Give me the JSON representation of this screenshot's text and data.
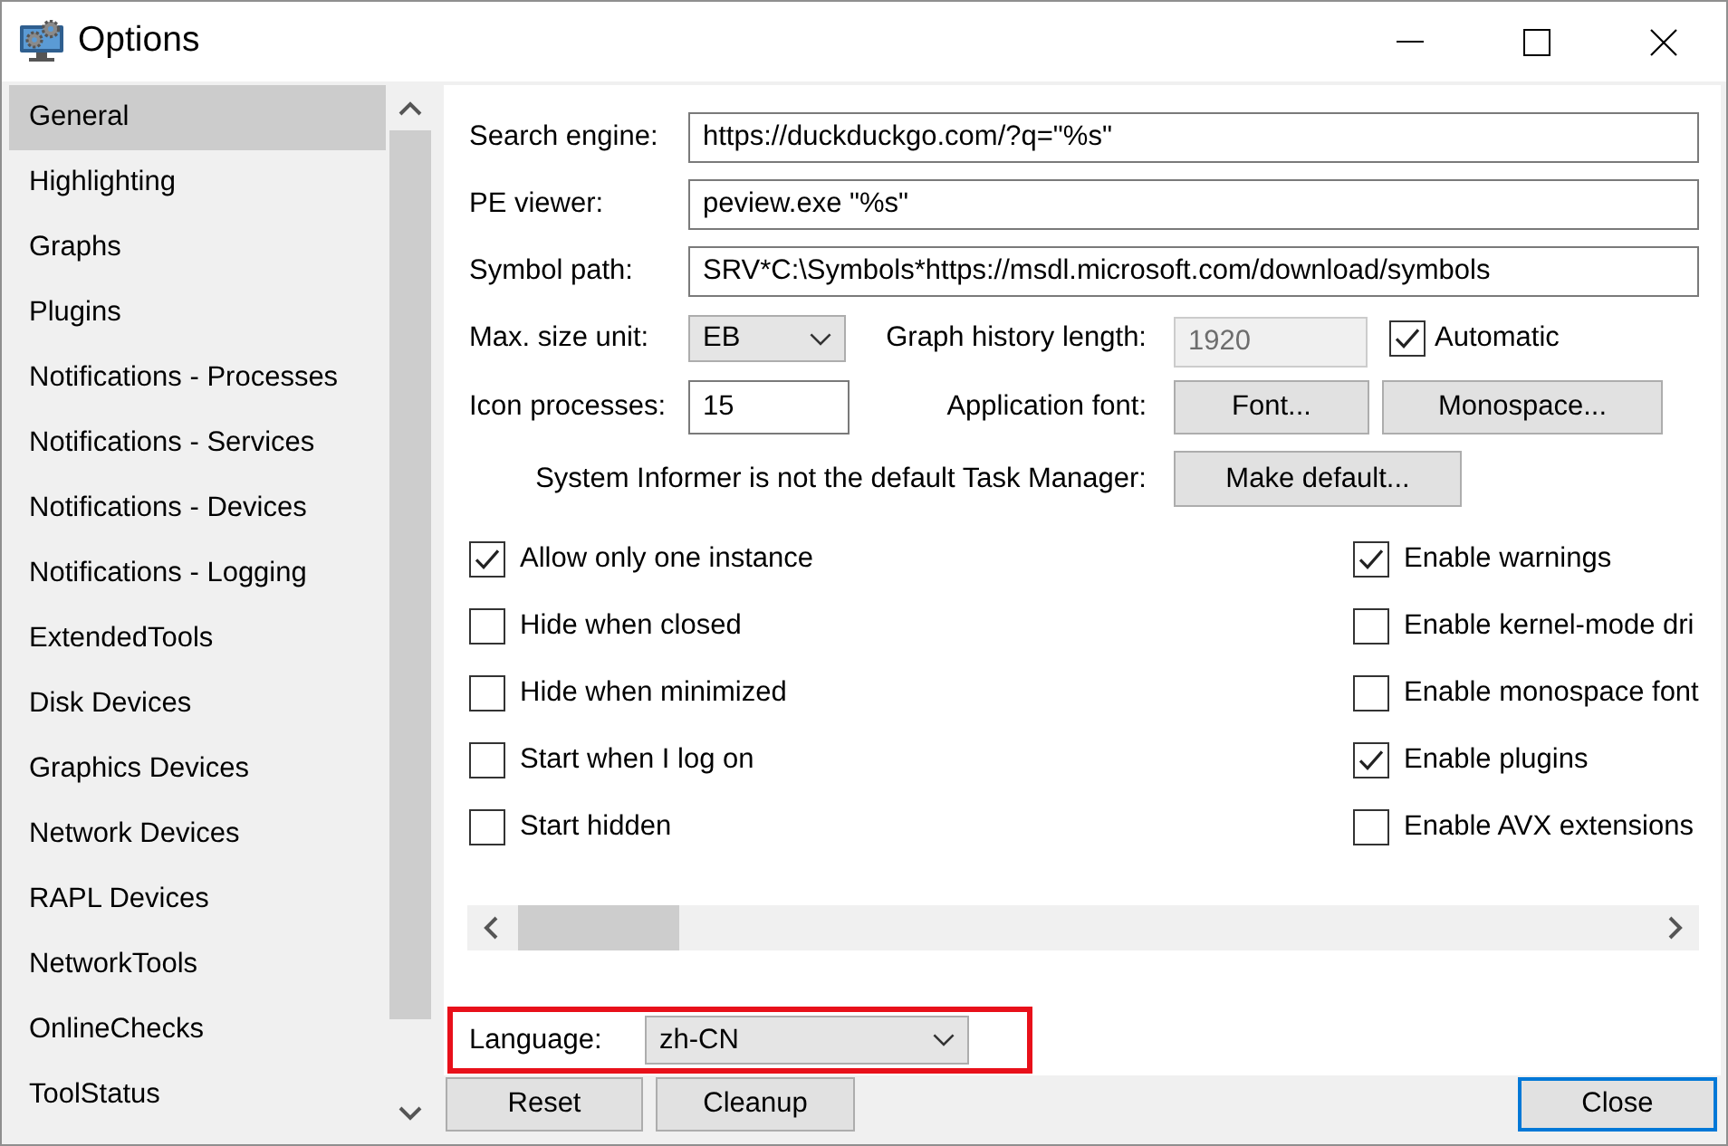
{
  "window": {
    "title": "Options"
  },
  "sidebar": {
    "items": [
      {
        "label": "General",
        "selected": true
      },
      {
        "label": "Highlighting",
        "selected": false
      },
      {
        "label": "Graphs",
        "selected": false
      },
      {
        "label": "Plugins",
        "selected": false
      },
      {
        "label": "Notifications - Processes",
        "selected": false
      },
      {
        "label": "Notifications - Services",
        "selected": false
      },
      {
        "label": "Notifications - Devices",
        "selected": false
      },
      {
        "label": "Notifications - Logging",
        "selected": false
      },
      {
        "label": "ExtendedTools",
        "selected": false
      },
      {
        "label": "Disk Devices",
        "selected": false
      },
      {
        "label": "Graphics Devices",
        "selected": false
      },
      {
        "label": "Network Devices",
        "selected": false
      },
      {
        "label": "RAPL Devices",
        "selected": false
      },
      {
        "label": "NetworkTools",
        "selected": false
      },
      {
        "label": "OnlineChecks",
        "selected": false
      },
      {
        "label": "ToolStatus",
        "selected": false
      }
    ]
  },
  "general": {
    "fields": [
      {
        "label": "Search engine:",
        "value": "https://duckduckgo.com/?q=\"%s\""
      },
      {
        "label": "PE viewer:",
        "value": "peview.exe \"%s\""
      },
      {
        "label": "Symbol path:",
        "value": "SRV*C:\\Symbols*https://msdl.microsoft.com/download/symbols"
      }
    ],
    "max_size_unit": {
      "label": "Max. size unit:",
      "value": "EB"
    },
    "graph_history_length": {
      "label": "Graph history length:",
      "value": "1920",
      "disabled": true
    },
    "automatic": {
      "label": "Automatic",
      "checked": true
    },
    "icon_processes": {
      "label": "Icon processes:",
      "value": "15"
    },
    "application_font": {
      "label": "Application font:",
      "buttons": [
        "Font...",
        "Monospace..."
      ]
    },
    "default_task_manager": {
      "label": "System Informer is not the default Task Manager:",
      "button": "Make default..."
    },
    "options_left": [
      {
        "label": "Allow only one instance",
        "checked": true
      },
      {
        "label": "Hide when closed",
        "checked": false
      },
      {
        "label": "Hide when minimized",
        "checked": false
      },
      {
        "label": "Start when I log on",
        "checked": false
      },
      {
        "label": "Start hidden",
        "checked": false
      }
    ],
    "options_right": [
      {
        "label": "Enable warnings",
        "checked": true
      },
      {
        "label": "Enable kernel-mode dri",
        "checked": false
      },
      {
        "label": "Enable monospace font",
        "checked": false
      },
      {
        "label": "Enable plugins",
        "checked": true
      },
      {
        "label": "Enable AVX extensions",
        "checked": false
      }
    ]
  },
  "language": {
    "label": "Language:",
    "value": "zh-CN",
    "highlighted": true
  },
  "buttons": [
    {
      "label": "Reset",
      "default": false
    },
    {
      "label": "Cleanup",
      "default": false
    },
    {
      "label": "Close",
      "default": true
    }
  ]
}
